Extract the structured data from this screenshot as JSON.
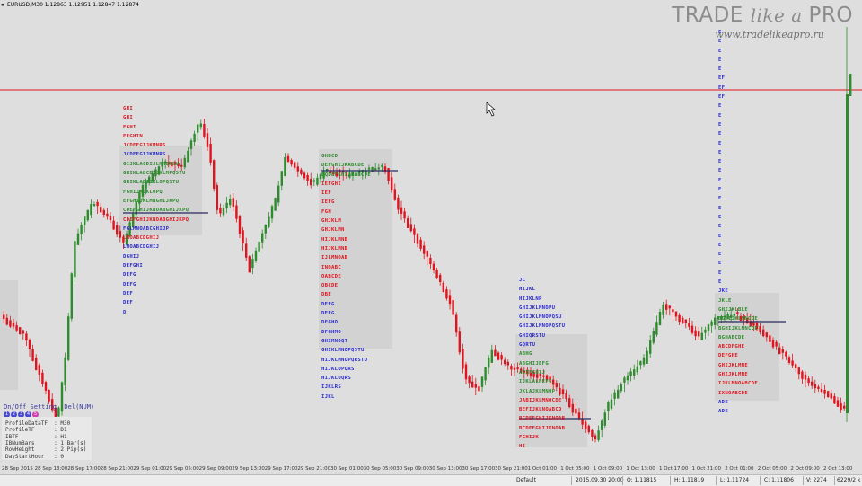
{
  "window": {
    "title": "EURUSD,M30  1.12863 1.12951 1.12847 1.12874",
    "menu_icon": "window-menu-icon"
  },
  "logo": {
    "brand_1": "TRADE ",
    "brand_2": "like a ",
    "brand_3": "PRO",
    "url": "www.tradelikeapro.ru"
  },
  "colors": {
    "bull": "#2e8b2e",
    "bear": "#e0141e",
    "profile_red": "#e0141e",
    "profile_blue": "#2a2ad0",
    "profile_green": "#2e8b2e",
    "hline": "#e0141e"
  },
  "profiles": [
    {
      "id": "p1",
      "lines": [
        {
          "t": "GHI",
          "c": "r"
        },
        {
          "t": "GHI",
          "c": "r"
        },
        {
          "t": "EGHI",
          "c": "r"
        },
        {
          "t": "EFGHIN",
          "c": "r"
        },
        {
          "t": "JCDEFGIJKMNRS",
          "c": "r"
        },
        {
          "t": "JCDEFGIJKMNRS",
          "c": "b"
        },
        {
          "t": "GIJKLACDIJLMNQRSU",
          "c": "g"
        },
        {
          "t": "GHIKLABCDIJKLMPQSTU",
          "c": "g"
        },
        {
          "t": "GHIKLABIJKLOPQSTU",
          "c": "g"
        },
        {
          "t": "FGHIJKLKLOPQ",
          "c": "g"
        },
        {
          "t": "EFGHIJKLMNGHIJKPQ",
          "c": "g"
        },
        {
          "t": "CDEFGHIJKNOABGHIJKPQ",
          "c": "g"
        },
        {
          "t": "CDEFGHIJKNOABGHIJKPQ",
          "c": "r"
        },
        {
          "t": "FGLMNOABCGHIJP",
          "c": "b"
        },
        {
          "t": "LMOABCDGHIJ",
          "c": "r"
        },
        {
          "t": "LMOABCDGHIJ",
          "c": "b"
        },
        {
          "t": "DGHIJ",
          "c": "b"
        },
        {
          "t": "DEFGHI",
          "c": "b"
        },
        {
          "t": "DEFG",
          "c": "b"
        },
        {
          "t": "DEFG",
          "c": "b"
        },
        {
          "t": "DEF",
          "c": "b"
        },
        {
          "t": "DEF",
          "c": "b"
        },
        {
          "t": "D",
          "c": "b"
        }
      ]
    },
    {
      "id": "p2",
      "lines": [
        {
          "t": "GHBCD",
          "c": "g"
        },
        {
          "t": "DEFGHIJKABCDE",
          "c": "g"
        },
        {
          "t": "BCDEFGHIJKABCDE",
          "c": "g"
        },
        {
          "t": "IEFGHI",
          "c": "r"
        },
        {
          "t": "IEF",
          "c": "r"
        },
        {
          "t": "IEFG",
          "c": "r"
        },
        {
          "t": "FGH",
          "c": "r"
        },
        {
          "t": "GHJKLM",
          "c": "r"
        },
        {
          "t": "GHJKLMN",
          "c": "r"
        },
        {
          "t": "HIJKLMNB",
          "c": "r"
        },
        {
          "t": "HIJKLMNB",
          "c": "r"
        },
        {
          "t": "IJLMNOAB",
          "c": "r"
        },
        {
          "t": "INOABC",
          "c": "r"
        },
        {
          "t": "OABCDE",
          "c": "r"
        },
        {
          "t": "OBCDE",
          "c": "r"
        },
        {
          "t": "DBE",
          "c": "r"
        },
        {
          "t": "DEFG",
          "c": "b"
        },
        {
          "t": "DEFG",
          "c": "b"
        },
        {
          "t": "DFGHO",
          "c": "b"
        },
        {
          "t": "DFGHMO",
          "c": "b"
        },
        {
          "t": "GHIMNOQT",
          "c": "b"
        },
        {
          "t": "GHIKLMNOPQSTU",
          "c": "b"
        },
        {
          "t": "HIJKLMNOPQRSTU",
          "c": "b"
        },
        {
          "t": "HIJKLOPQRS",
          "c": "b"
        },
        {
          "t": "HIJKLOQRS",
          "c": "b"
        },
        {
          "t": "IJKLRS",
          "c": "b"
        },
        {
          "t": "IJKL",
          "c": "b"
        }
      ]
    },
    {
      "id": "p3",
      "lines": [
        {
          "t": "JL",
          "c": "b"
        },
        {
          "t": "HIJKL",
          "c": "b"
        },
        {
          "t": "HIJKLNP",
          "c": "b"
        },
        {
          "t": "GHIJKLMNOPU",
          "c": "b"
        },
        {
          "t": "GHIJKLMNOPQSU",
          "c": "b"
        },
        {
          "t": "GHIJKLMNOPQSTU",
          "c": "b"
        },
        {
          "t": "GHIQRSTU",
          "c": "b"
        },
        {
          "t": "GQRTU",
          "c": "b"
        },
        {
          "t": "ABHG",
          "c": "g"
        },
        {
          "t": "ABGHIJEFG",
          "c": "g"
        },
        {
          "t": "ACEFGHIJ",
          "c": "g"
        },
        {
          "t": "IJKLALNEFG",
          "c": "g"
        },
        {
          "t": "JKLAJKLMNOP",
          "c": "g"
        },
        {
          "t": "JABIJKLMNOCDE",
          "c": "r"
        },
        {
          "t": "BEFIJKLNOABCD",
          "c": "r"
        },
        {
          "t": "BCDEFGHIJKNOAB",
          "c": "r"
        },
        {
          "t": "BCDEFGHIJKNOAB",
          "c": "r"
        },
        {
          "t": "FGHIJK",
          "c": "r"
        },
        {
          "t": "HI",
          "c": "r"
        }
      ]
    },
    {
      "id": "p4",
      "lines": [
        {
          "t": "E",
          "c": "b"
        },
        {
          "t": "E",
          "c": "b"
        },
        {
          "t": "E",
          "c": "b"
        },
        {
          "t": "E",
          "c": "b"
        },
        {
          "t": "E",
          "c": "b"
        },
        {
          "t": "EF",
          "c": "b"
        },
        {
          "t": "EF",
          "c": "b"
        },
        {
          "t": "EF",
          "c": "b"
        },
        {
          "t": "E",
          "c": "b"
        },
        {
          "t": "E",
          "c": "b"
        },
        {
          "t": "E",
          "c": "b"
        },
        {
          "t": "E",
          "c": "b"
        },
        {
          "t": "E",
          "c": "b"
        },
        {
          "t": "E",
          "c": "b"
        },
        {
          "t": "E",
          "c": "b"
        },
        {
          "t": "E",
          "c": "b"
        },
        {
          "t": "E",
          "c": "b"
        },
        {
          "t": "E",
          "c": "b"
        },
        {
          "t": "E",
          "c": "b"
        },
        {
          "t": "E",
          "c": "b"
        },
        {
          "t": "E",
          "c": "b"
        },
        {
          "t": "E",
          "c": "b"
        },
        {
          "t": "E",
          "c": "b"
        },
        {
          "t": "E",
          "c": "b"
        },
        {
          "t": "E",
          "c": "b"
        },
        {
          "t": "E",
          "c": "b"
        },
        {
          "t": "E",
          "c": "b"
        },
        {
          "t": "E",
          "c": "b"
        },
        {
          "t": "JKE",
          "c": "b"
        },
        {
          "t": "JKLE",
          "c": "g"
        },
        {
          "t": "GHIJKLBLE",
          "c": "g"
        },
        {
          "t": "BGHIJKLMNCDE",
          "c": "g"
        },
        {
          "t": "BGHIJKLMNCDE",
          "c": "g"
        },
        {
          "t": "BGHABCDE",
          "c": "g"
        },
        {
          "t": "ABCDFGHE",
          "c": "r"
        },
        {
          "t": "DEFGHE",
          "c": "r"
        },
        {
          "t": "GHIJKLMNE",
          "c": "r"
        },
        {
          "t": "GHIJKLMNE",
          "c": "r"
        },
        {
          "t": "IJKLMNOABCDE",
          "c": "r"
        },
        {
          "t": "IXNOABCDE",
          "c": "r"
        },
        {
          "t": "ADE",
          "c": "b"
        },
        {
          "t": "ADE",
          "c": "b"
        }
      ]
    }
  ],
  "panel": {
    "title": "On/Off Setting  Del(NUM)",
    "dots": [
      "1",
      "2",
      "3",
      "4",
      "5"
    ],
    "settings": [
      "ProfileDataTF  : M30",
      "ProfileTF      : D1",
      "IBTF           : H1",
      "IBNumBars      : 1 Bar(s)",
      "RowHeight      : 2 Pip(s)",
      "DayStartHour   : 0"
    ]
  },
  "xaxis": [
    "28 Sep 2015",
    "28 Sep 13:00",
    "28 Sep 17:00",
    "28 Sep 21:00",
    "29 Sep 01:00",
    "29 Sep 05:00",
    "29 Sep 09:00",
    "29 Sep 13:00",
    "29 Sep 17:00",
    "29 Sep 21:00",
    "30 Sep 01:00",
    "30 Sep 05:00",
    "30 Sep 09:00",
    "30 Sep 13:00",
    "30 Sep 17:00",
    "30 Sep 21:00",
    "1 Oct 01:00",
    "1 Oct 05:00",
    "1 Oct 09:00",
    "1 Oct 13:00",
    "1 Oct 17:00",
    "1 Oct 21:00",
    "2 Oct 01:00",
    "2 Oct 05:00",
    "2 Oct 09:00",
    "2 Oct 13:00"
  ],
  "status": {
    "profile": "Default",
    "time": "2015.09.30 20:00",
    "open": "O: 1.11815",
    "high": "H: 1.11819",
    "low": "L: 1.11724",
    "close": "C: 1.11806",
    "volume": "V: 2274",
    "traffic": "6229/2 k"
  }
}
